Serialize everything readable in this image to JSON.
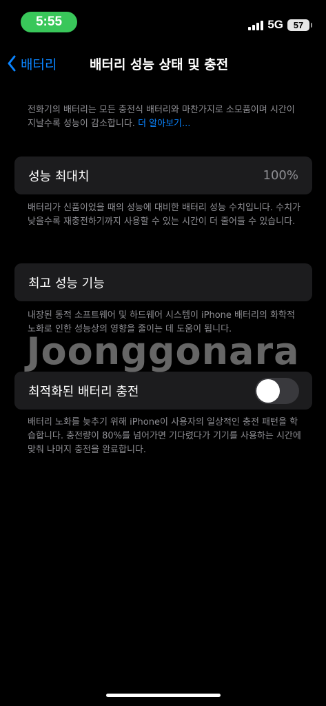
{
  "status_bar": {
    "time": "5:55",
    "network": "5G",
    "battery_level": "57",
    "time_pill_color": "#39c75a",
    "icons": [
      "signal-icon",
      "battery-icon"
    ]
  },
  "nav": {
    "back_label": "배터리",
    "title": "배터리 성능 상태 및 충전",
    "back_icon": "chevron-left-icon",
    "accent_color": "#0a84ff"
  },
  "intro": {
    "text": "전화기의 배터리는 모든 충전식 배터리와 마찬가지로 소모품이며 시간이 지날수록 성능이 감소합니다. ",
    "link": "더 알아보기..."
  },
  "max_capacity": {
    "label": "성능 최대치",
    "value": "100%",
    "footnote": "배터리가 신품이었을 때의 성능에 대비한 배터리 성능 수치입니다. 수치가 낮을수록 재충전하기까지 사용할 수 있는 시간이 더 줄어들 수 있습니다."
  },
  "peak_performance": {
    "label": "최고 성능 기능",
    "footnote": "내장된 동적 소프트웨어 및 하드웨어 시스템이 iPhone 배터리의 화학적 노화로 인한 성능상의 영향을 줄이는 데 도움이 됩니다."
  },
  "optimized_charging": {
    "label": "최적화된 배터리 충전",
    "enabled": false,
    "footnote": "배터리 노화를 늦추기 위해 iPhone이 사용자의 일상적인 충전 패턴을 학습합니다. 충전량이 80%를 넘어가면 기다렸다가 기기를 사용하는 시간에 맞춰 나머지 충전을 완료합니다."
  },
  "watermark": "Joonggonara"
}
